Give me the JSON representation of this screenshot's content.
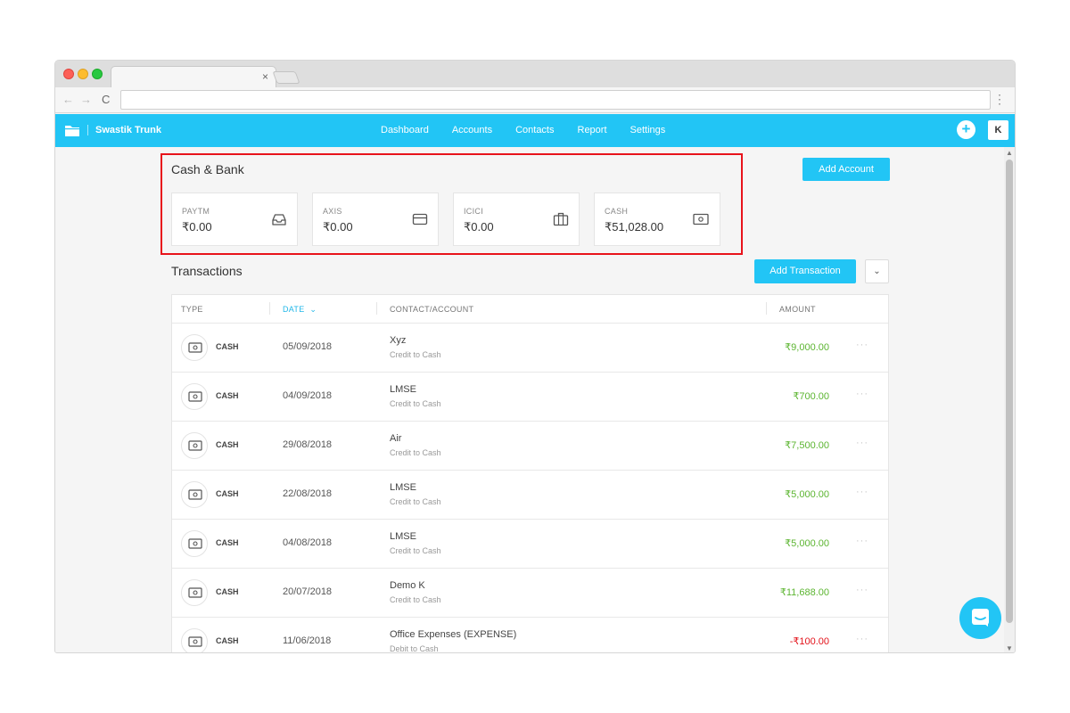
{
  "browser": {
    "tab_close": "×",
    "url": "",
    "nav_back": "←",
    "nav_forward": "→",
    "nav_reload": "C",
    "menu": "⋮"
  },
  "app": {
    "title": "Swastik Trunk",
    "nav": [
      "Dashboard",
      "Accounts",
      "Contacts",
      "Report",
      "Settings"
    ],
    "plus_label": "+",
    "avatar_initial": "K",
    "brand_color": "#22c5f5"
  },
  "cash_bank": {
    "title": "Cash & Bank",
    "add_account_label": "Add Account",
    "accounts": [
      {
        "name": "PAYTM",
        "balance": "₹0.00",
        "icon": "inbox-icon"
      },
      {
        "name": "AXIS",
        "balance": "₹0.00",
        "icon": "credit-card-icon"
      },
      {
        "name": "ICICI",
        "balance": "₹0.00",
        "icon": "briefcase-icon"
      },
      {
        "name": "CASH",
        "balance": "₹51,028.00",
        "icon": "cash-icon"
      }
    ]
  },
  "transactions": {
    "title": "Transactions",
    "add_label": "Add Transaction",
    "dropdown_icon": "⌄",
    "columns": {
      "type": "TYPE",
      "date": "DATE",
      "date_sort": "⌄",
      "contact": "CONTACT/ACCOUNT",
      "amount": "AMOUNT"
    },
    "rows": [
      {
        "type": "CASH",
        "date": "05/09/2018",
        "contact": "Xyz",
        "sub": "Credit to Cash",
        "amount": "₹9,000.00",
        "kind": "credit"
      },
      {
        "type": "CASH",
        "date": "04/09/2018",
        "contact": "LMSE",
        "sub": "Credit to Cash",
        "amount": "₹700.00",
        "kind": "credit"
      },
      {
        "type": "CASH",
        "date": "29/08/2018",
        "contact": "Air",
        "sub": "Credit to Cash",
        "amount": "₹7,500.00",
        "kind": "credit"
      },
      {
        "type": "CASH",
        "date": "22/08/2018",
        "contact": "LMSE",
        "sub": "Credit to Cash",
        "amount": "₹5,000.00",
        "kind": "credit"
      },
      {
        "type": "CASH",
        "date": "04/08/2018",
        "contact": "LMSE",
        "sub": "Credit to Cash",
        "amount": "₹5,000.00",
        "kind": "credit"
      },
      {
        "type": "CASH",
        "date": "20/07/2018",
        "contact": "Demo K",
        "sub": "Credit to Cash",
        "amount": "₹11,688.00",
        "kind": "credit"
      },
      {
        "type": "CASH",
        "date": "11/06/2018",
        "contact": "Office Expenses (EXPENSE)",
        "sub": "Debit to Cash",
        "amount": "-₹100.00",
        "kind": "debit"
      }
    ],
    "more_label": "···",
    "credit_color": "#5cb531",
    "debit_color": "#e3131b"
  },
  "annotation": {
    "highlight_color": "#e8131b"
  }
}
